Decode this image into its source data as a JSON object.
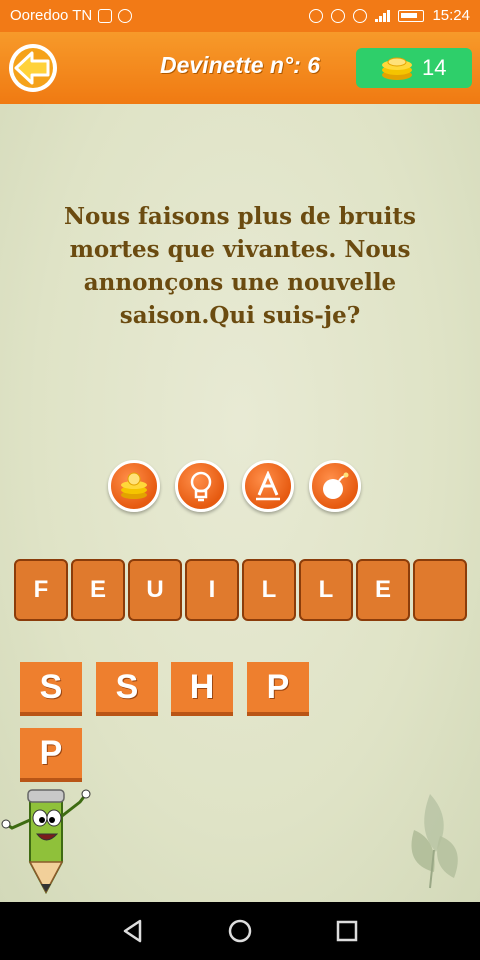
{
  "status": {
    "carrier": "Ooredoo TN",
    "time": "15:24"
  },
  "header": {
    "title": "Devinette n°: 6",
    "coins": "14"
  },
  "question": "Nous faisons plus de bruits mortes que vivantes. Nous annonçons une nouvelle saison.Qui suis-je?",
  "powerups": [
    "coins-icon",
    "lightbulb-icon",
    "letter-a-icon",
    "bomb-icon"
  ],
  "answer_slots": [
    "F",
    "E",
    "U",
    "I",
    "L",
    "L",
    "E",
    ""
  ],
  "letters": [
    "S",
    "S",
    "H",
    "P",
    "P"
  ],
  "colors": {
    "header": "#f27a16",
    "coins_badge": "#2ecf6a",
    "tile": "#e07a2d",
    "question_text": "#6b4b10"
  }
}
